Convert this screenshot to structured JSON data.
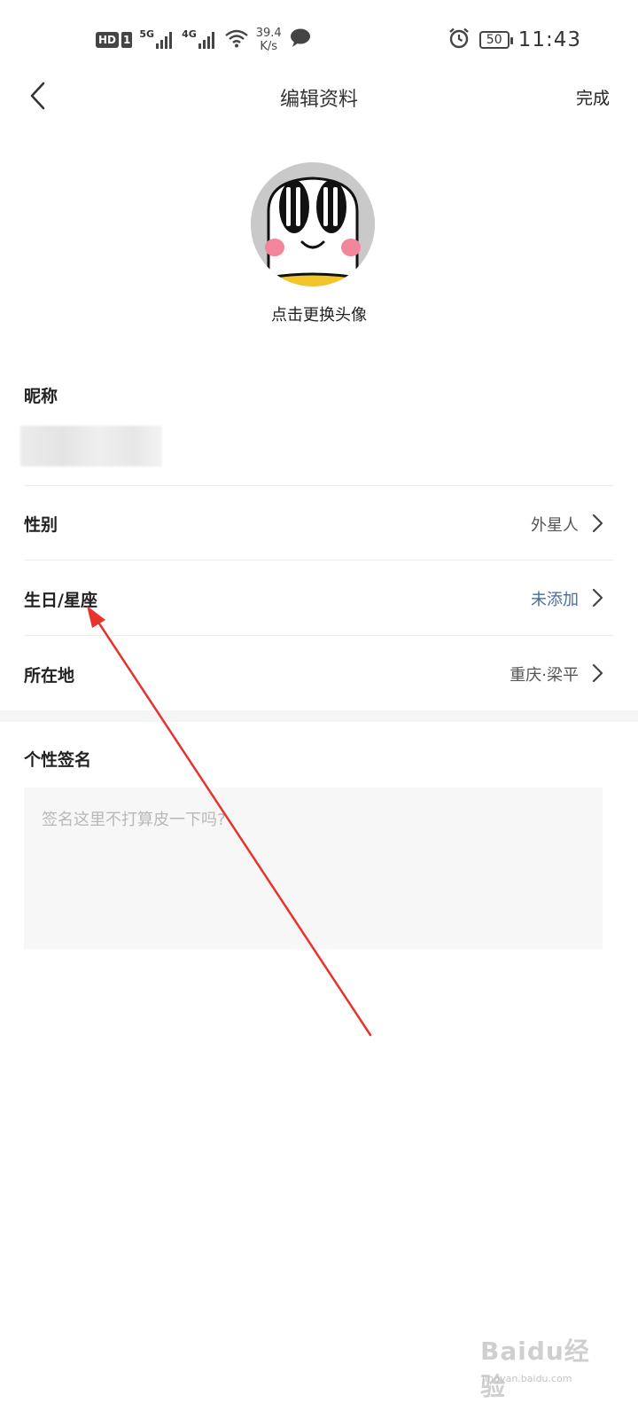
{
  "status_bar": {
    "hd": "HD",
    "sim": "1",
    "net1": "5G",
    "net2": "4G",
    "speed_value": "39.4",
    "speed_unit": "K/s",
    "battery": "50",
    "time": "11:43"
  },
  "nav": {
    "title": "编辑资料",
    "done": "完成"
  },
  "avatar": {
    "hint": "点击更换头像"
  },
  "form": {
    "nickname_label": "昵称",
    "gender_label": "性别",
    "gender_value": "外星人",
    "birthday_label": "生日/星座",
    "birthday_value": "未添加",
    "location_label": "所在地",
    "location_value": "重庆·梁平",
    "signature_label": "个性签名",
    "signature_placeholder": "签名这里不打算皮一下吗?"
  },
  "colors": {
    "accent": "#4a6d9a",
    "annotation": "#e8322b"
  },
  "watermark": {
    "main": "Baidu经验",
    "sub": "jingyan.baidu.com"
  }
}
